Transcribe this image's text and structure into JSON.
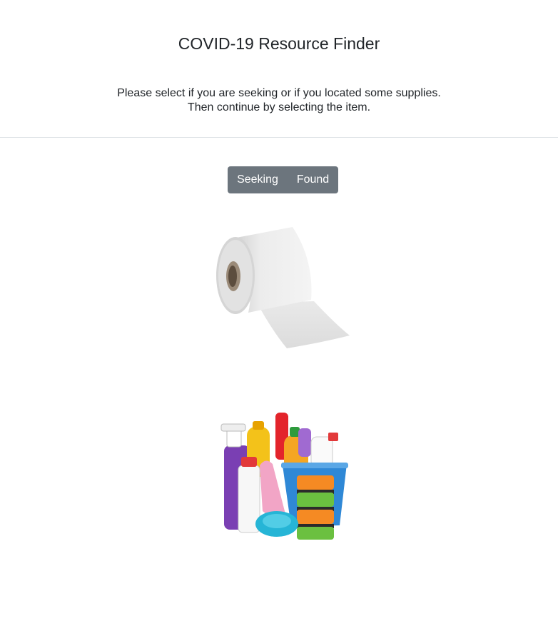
{
  "header": {
    "title": "COVID-19 Resource Finder",
    "instructions_line1": "Please select if you are seeking or if you located some supplies.",
    "instructions_line2": "Then continue by selecting the item."
  },
  "mode_toggle": {
    "seeking_label": "Seeking",
    "found_label": "Found",
    "background_color": "#6c757d"
  },
  "items": [
    {
      "icon": "toilet-paper-roll"
    },
    {
      "icon": "cleaning-supplies"
    }
  ]
}
